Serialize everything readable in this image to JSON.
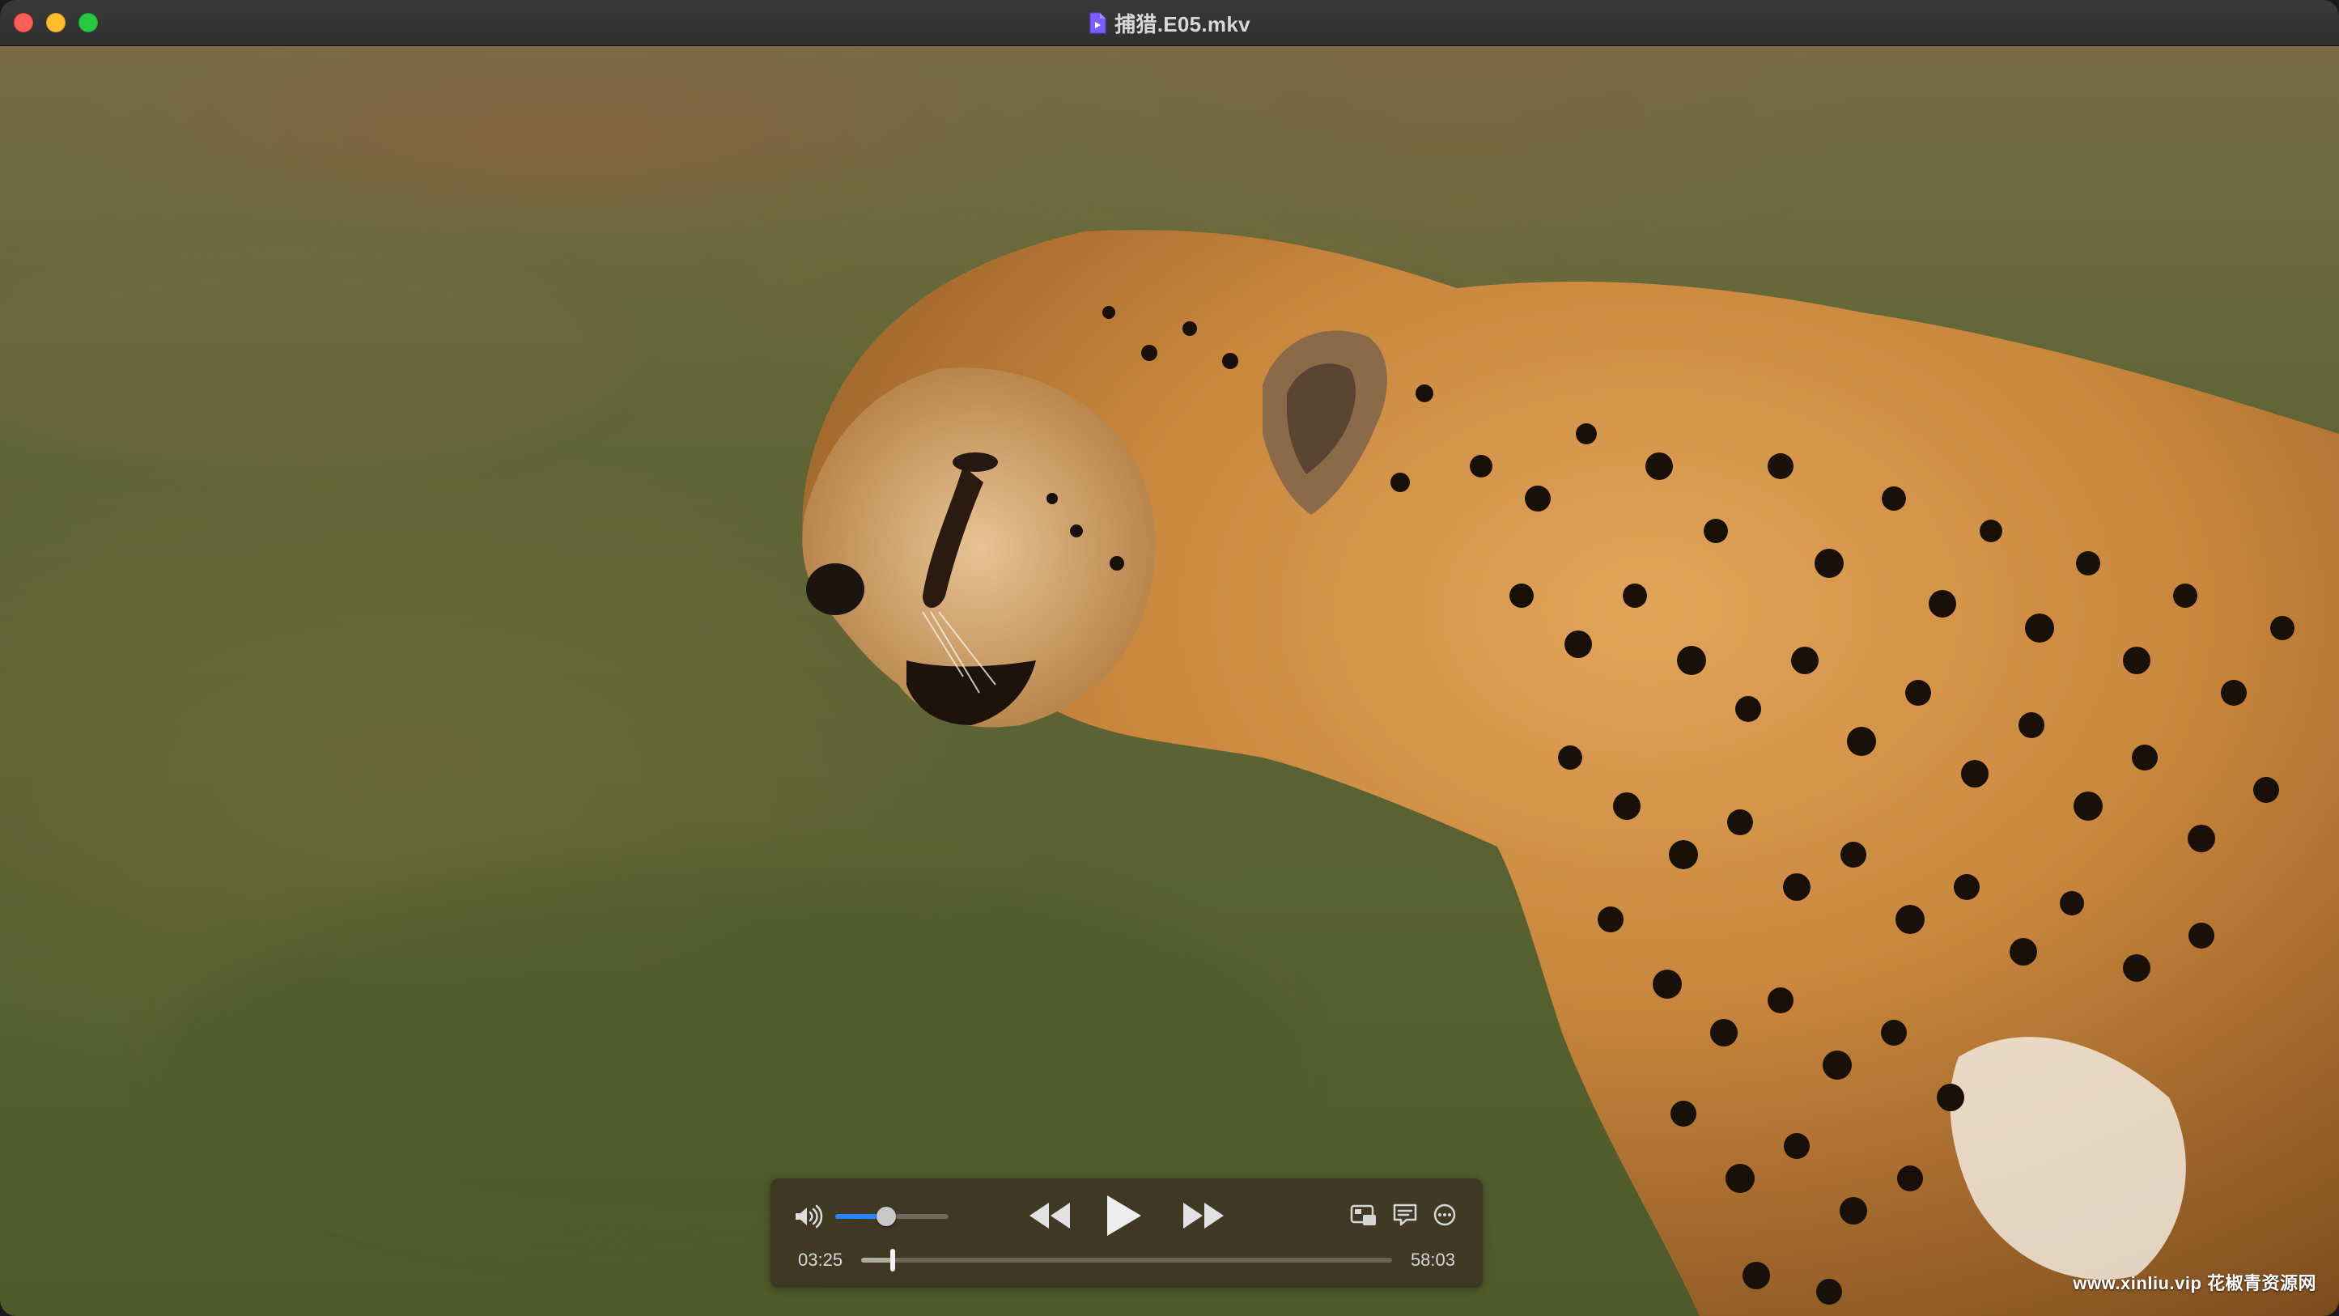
{
  "window": {
    "title": "捕猎.E05.mkv",
    "file_icon": "mkv-video-file-icon"
  },
  "video": {
    "content": "cheetah",
    "watermark": "www.xinliu.vip 花椒青资源网"
  },
  "controls": {
    "volume_icon": "speaker-high-icon",
    "volume_level": 0.45,
    "rewind_icon": "rewind-icon",
    "play_icon": "play-icon",
    "ffwd_icon": "fast-forward-icon",
    "pip_icon": "picture-in-picture-icon",
    "subtitles_icon": "subtitles-icon",
    "more_icon": "more-options-icon",
    "current_time": "03:25",
    "duration": "58:03",
    "progress": 0.059,
    "accent_color": "#2a84ff"
  }
}
